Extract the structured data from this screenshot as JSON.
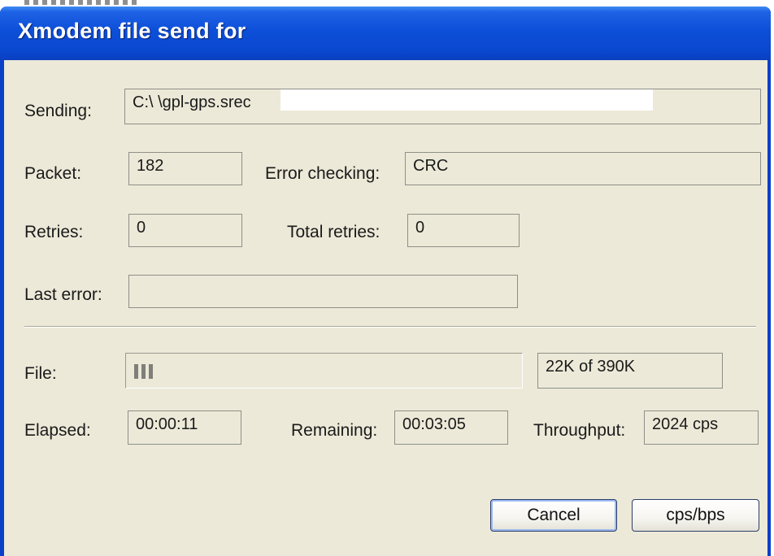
{
  "window": {
    "title": "Xmodem file send for"
  },
  "fields": {
    "sending": {
      "label": "Sending:",
      "value": "C:\\ \\gpl-gps.srec"
    },
    "packet": {
      "label": "Packet:",
      "value": "182"
    },
    "error_checking": {
      "label": "Error checking:",
      "value": "CRC"
    },
    "retries": {
      "label": "Retries:",
      "value": "0"
    },
    "total_retries": {
      "label": "Total retries:",
      "value": "0"
    },
    "last_error": {
      "label": "Last error:",
      "value": ""
    }
  },
  "file": {
    "label": "File:",
    "progress_fraction": 0.0564,
    "size_text": "22K of 390K"
  },
  "stats": {
    "elapsed": {
      "label": "Elapsed:",
      "value": "00:00:11"
    },
    "remaining": {
      "label": "Remaining:",
      "value": "00:03:05"
    },
    "throughput": {
      "label": "Throughput:",
      "value": "2024 cps"
    }
  },
  "buttons": {
    "cancel": "Cancel",
    "cps_bps": "cps/bps"
  }
}
